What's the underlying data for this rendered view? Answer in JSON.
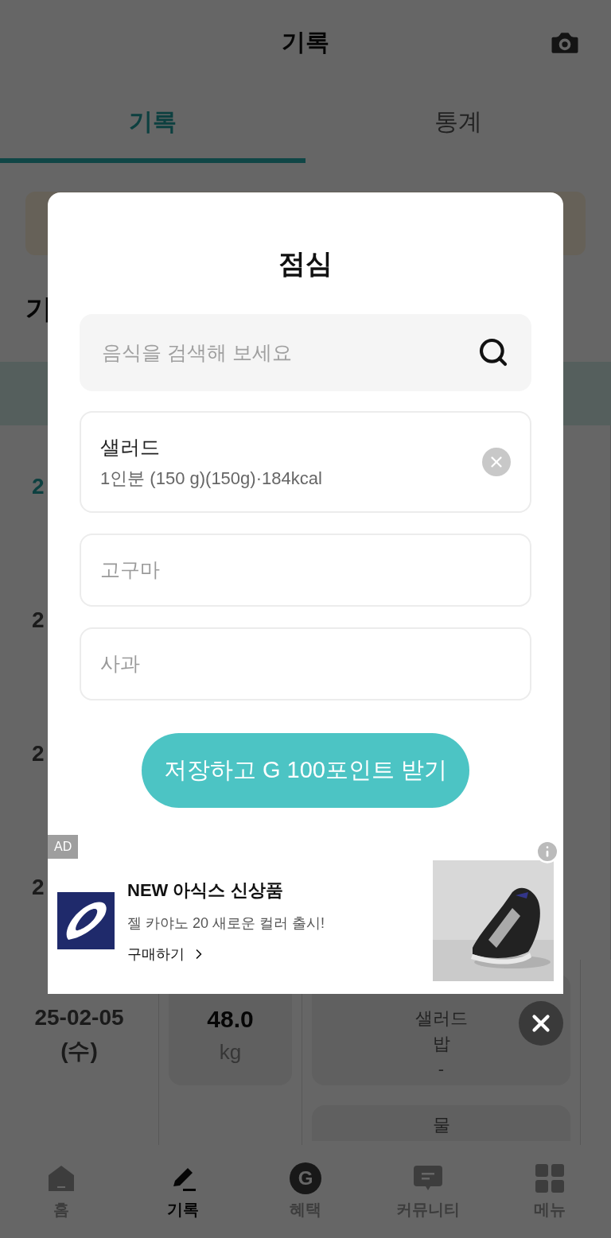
{
  "header": {
    "title": "기록"
  },
  "tabs": [
    {
      "label": "기록",
      "selected": true
    },
    {
      "label": "통계",
      "selected": false
    }
  ],
  "section_title": "기",
  "record_stubs": [
    {
      "date": "2",
      "selected": true
    },
    {
      "date": "2",
      "selected": false
    },
    {
      "date": "2",
      "selected": false
    },
    {
      "date": "2",
      "selected": false
    }
  ],
  "record": {
    "date": "25-02-05",
    "weekday": "(수)",
    "weight": "48.0",
    "unit": "kg",
    "meals": [
      "샐러드",
      "밥",
      "-"
    ],
    "next_meals": [
      "물"
    ]
  },
  "modal": {
    "title": "점심",
    "search": {
      "placeholder": "음식을 검색해 보세요"
    },
    "foods": [
      {
        "kind": "selected",
        "name": "샐러드",
        "detail": "1인분 (150 g)(150g)·184kcal"
      },
      {
        "kind": "suggestion",
        "name": "고구마"
      },
      {
        "kind": "suggestion",
        "name": "사과"
      }
    ],
    "save_button": "저장하고 G 100포인트 받기"
  },
  "ad": {
    "badge": "AD",
    "title": "NEW 아식스 신상품",
    "text": "젤 카야노 20 새로운 컬러 출시!",
    "link": "구매하기"
  },
  "nav": [
    {
      "kind": "home",
      "label": "홈",
      "selected": false
    },
    {
      "kind": "record",
      "label": "기록",
      "selected": true
    },
    {
      "kind": "benefit",
      "label": "혜택",
      "glyph": "G",
      "selected": false
    },
    {
      "kind": "community",
      "label": "커뮤니티",
      "selected": false
    },
    {
      "kind": "menu",
      "label": "메뉴",
      "selected": false
    }
  ]
}
